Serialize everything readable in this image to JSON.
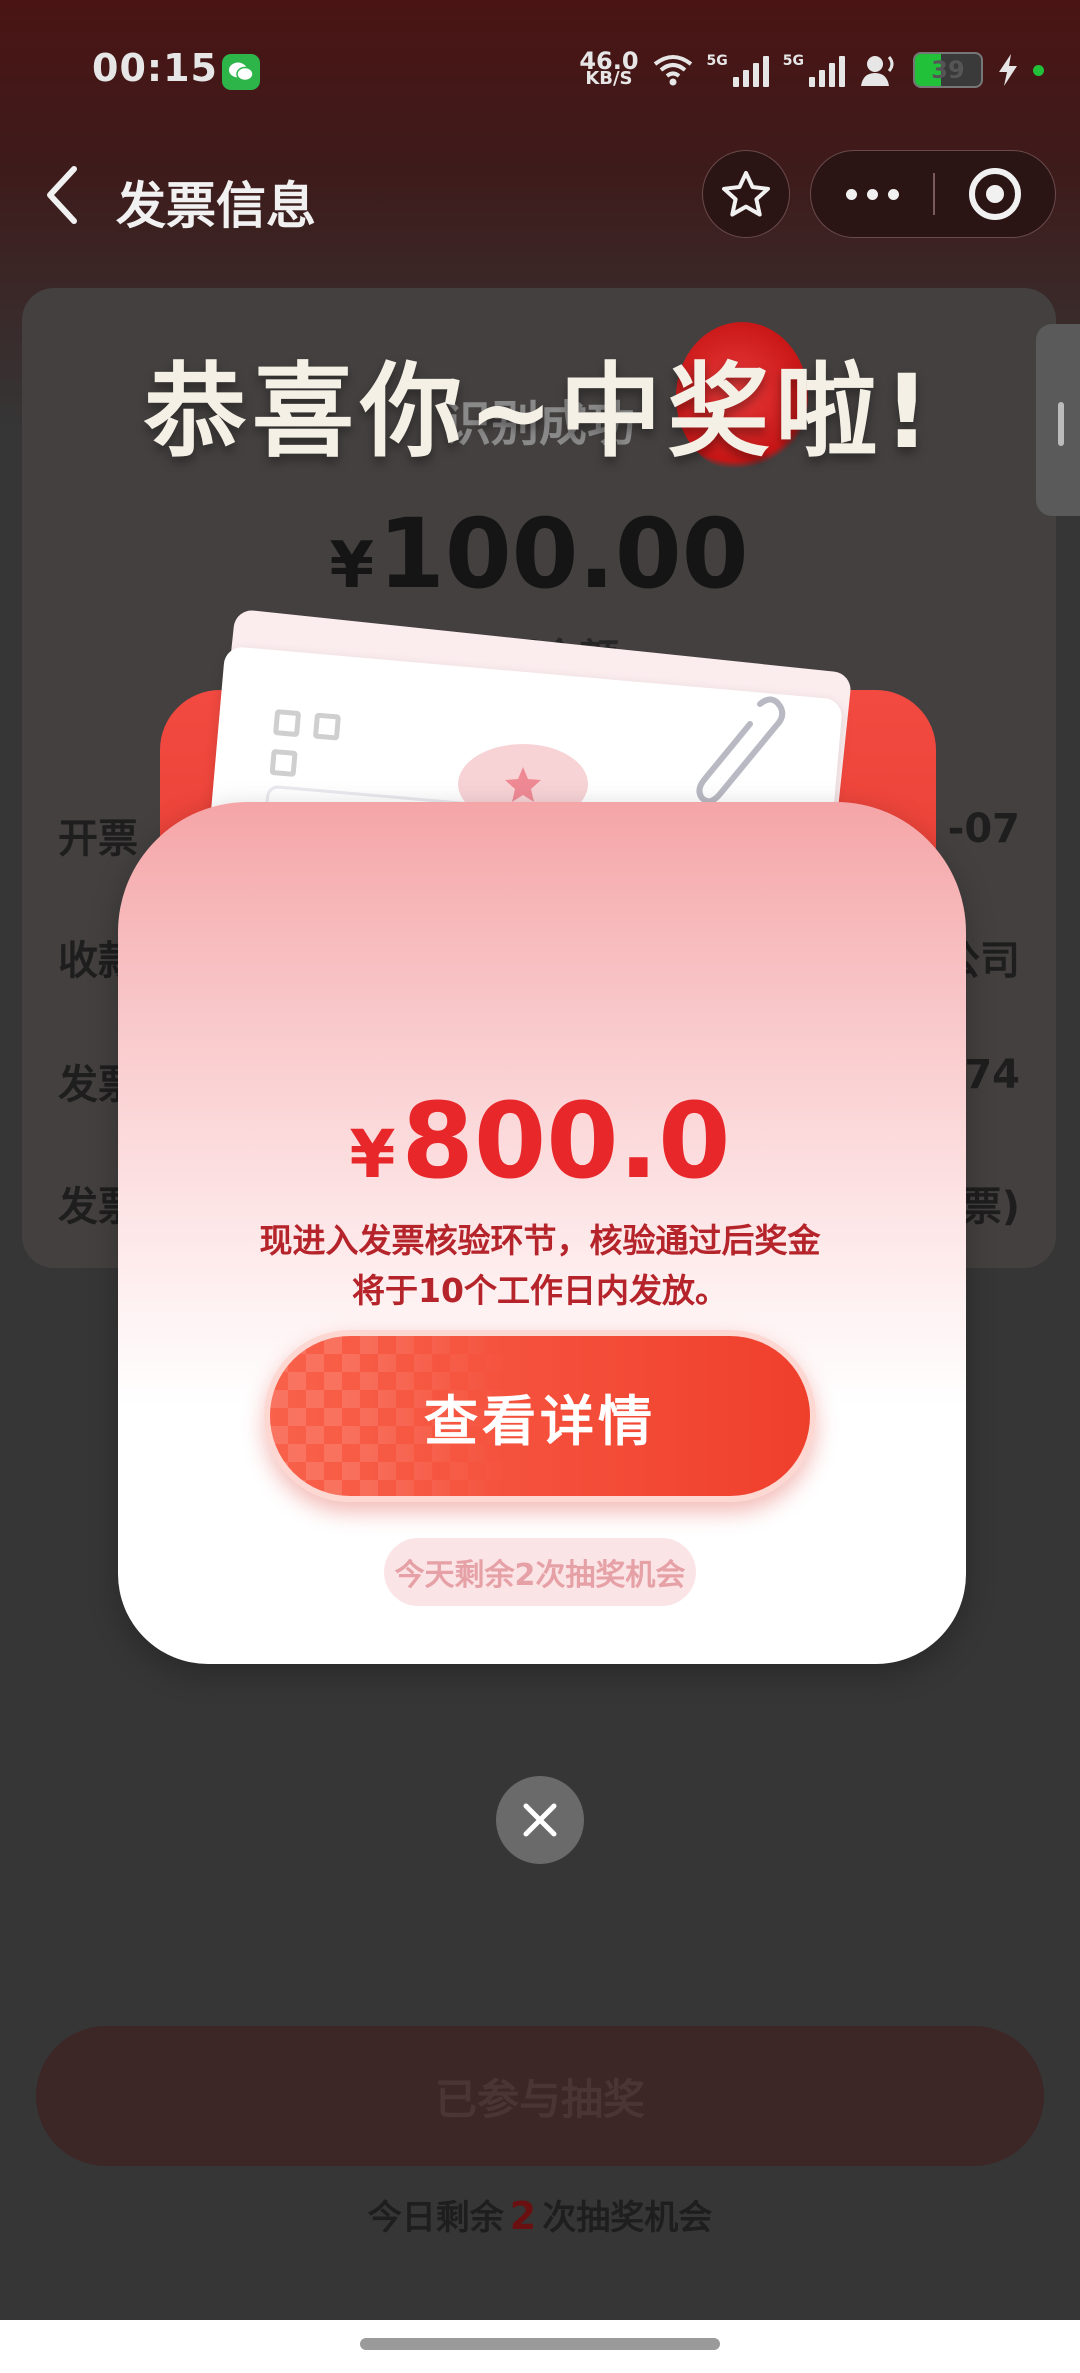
{
  "status_bar": {
    "time": "00:15",
    "net_speed_value": "46.0",
    "net_speed_unit": "KB/S",
    "signal1_label": "5G",
    "signal2_label": "5G",
    "battery": "39",
    "battery_level": 0.39,
    "icons": [
      "wechat-icon",
      "wifi-icon",
      "signal-icon",
      "headset-icon",
      "battery-icon",
      "charging-icon"
    ]
  },
  "navbar": {
    "title": "发票信息",
    "back_icon": "chevron-left-icon",
    "favorite_icon": "star-outline-icon",
    "more_icon": "more-icon",
    "close_icon": "target-icon"
  },
  "invoice_card": {
    "status": "识别成功",
    "currency": "¥",
    "amount": "100.00",
    "amount_label": "开票金额",
    "rows": [
      {
        "key": "开票",
        "value": "-07"
      },
      {
        "key": "收款",
        "value": "公司"
      },
      {
        "key": "发票",
        "value": "574"
      },
      {
        "key": "发票",
        "value": "票)"
      }
    ]
  },
  "footer": {
    "joined_button": "已参与抽奖",
    "chances_prefix": "今日剩余",
    "chances_count": "2",
    "chances_suffix": "次抽奖机会"
  },
  "popup": {
    "title": "恭喜你~中奖啦!",
    "prize_currency": "¥",
    "prize_amount": "800.0",
    "description": "现进入发票核验环节，核验通过后奖金将于10个工作日内发放。",
    "detail_button": "查看详情",
    "remaining_chances": "今天剩余2次抽奖机会",
    "close_icon": "close-icon"
  },
  "colors": {
    "accent_red": "#e8272a",
    "button_red": "#ef3f2c",
    "description_red": "#b5242a"
  }
}
